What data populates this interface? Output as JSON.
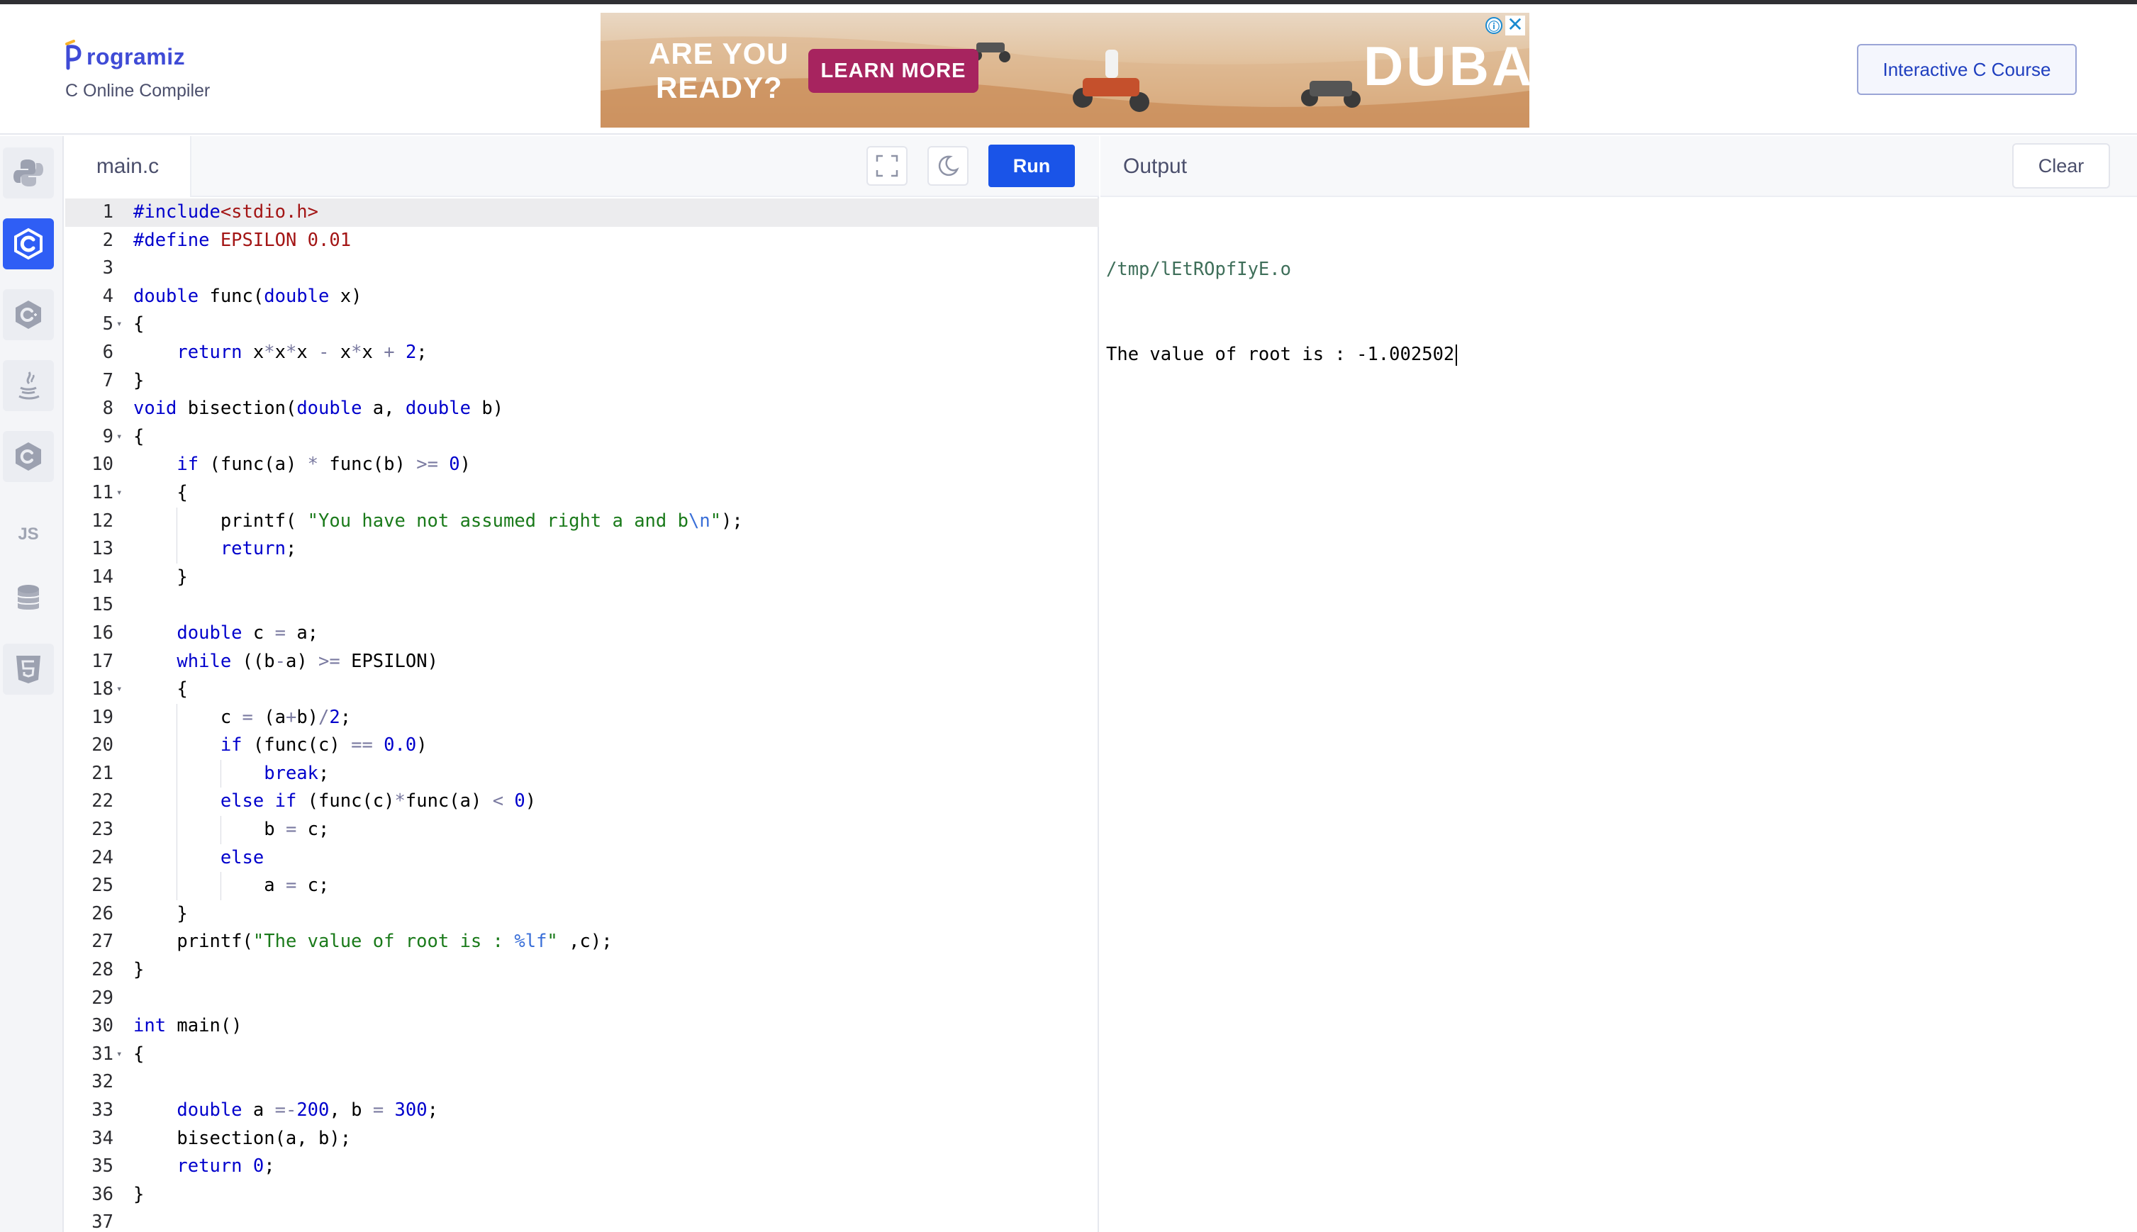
{
  "header": {
    "logo_text": "rogramiz",
    "logo_initial": "P",
    "subtitle": "C Online Compiler",
    "course_button": "Interactive C Course"
  },
  "ad": {
    "headline_1": "ARE YOU",
    "headline_2": "READY?",
    "cta": "LEARN MORE",
    "brand": "DUBAI",
    "info_icon": "ⓘ",
    "close_icon": "✕"
  },
  "sidebar": {
    "items": [
      {
        "icon": "python-icon",
        "active": false
      },
      {
        "icon": "c-icon",
        "active": true
      },
      {
        "icon": "cpp-icon",
        "active": false
      },
      {
        "icon": "java-icon",
        "active": false
      },
      {
        "icon": "csharp-icon",
        "active": false
      },
      {
        "icon": "js-icon",
        "label": "JS",
        "active": false
      },
      {
        "icon": "database-icon",
        "active": false
      },
      {
        "icon": "html5-icon",
        "active": false
      }
    ]
  },
  "editor": {
    "file_tab": "main.c",
    "run_label": "Run",
    "lines": [
      "#include<stdio.h>",
      "#define EPSILON 0.01",
      "",
      "double func(double x)",
      "{",
      "    return x*x*x - x*x + 2;",
      "}",
      "void bisection(double a, double b)",
      "{",
      "    if (func(a) * func(b) >= 0)",
      "    {",
      "        printf( \"You have not assumed right a and b\\n\");",
      "        return;",
      "    }",
      "",
      "    double c = a;",
      "    while ((b-a) >= EPSILON)",
      "    {",
      "        c = (a+b)/2;",
      "        if (func(c) == 0.0)",
      "            break;",
      "        else if (func(c)*func(a) < 0)",
      "            b = c;",
      "        else",
      "            a = c;",
      "    }",
      "    printf(\"The value of root is : %lf\" ,c);",
      "}",
      "",
      "int main()",
      "{",
      "",
      "    double a =-200, b = 300;",
      "    bisection(a, b);",
      "    return 0;",
      "}",
      ""
    ],
    "line_numbers": [
      "1",
      "2",
      "3",
      "4",
      "5",
      "6",
      "7",
      "8",
      "9",
      "10",
      "11",
      "12",
      "13",
      "14",
      "15",
      "16",
      "17",
      "18",
      "19",
      "20",
      "21",
      "22",
      "23",
      "24",
      "25",
      "26",
      "27",
      "28",
      "29",
      "30",
      "31",
      "32",
      "33",
      "34",
      "35",
      "36",
      "37"
    ]
  },
  "output": {
    "title": "Output",
    "clear_label": "Clear",
    "lines": [
      "/tmp/lEtROpfIyE.o",
      "The value of root is : -1.002502"
    ]
  },
  "colors": {
    "accent": "#1a54e8",
    "active_lang": "#2f5ef5",
    "ad_button": "#a7245f"
  }
}
